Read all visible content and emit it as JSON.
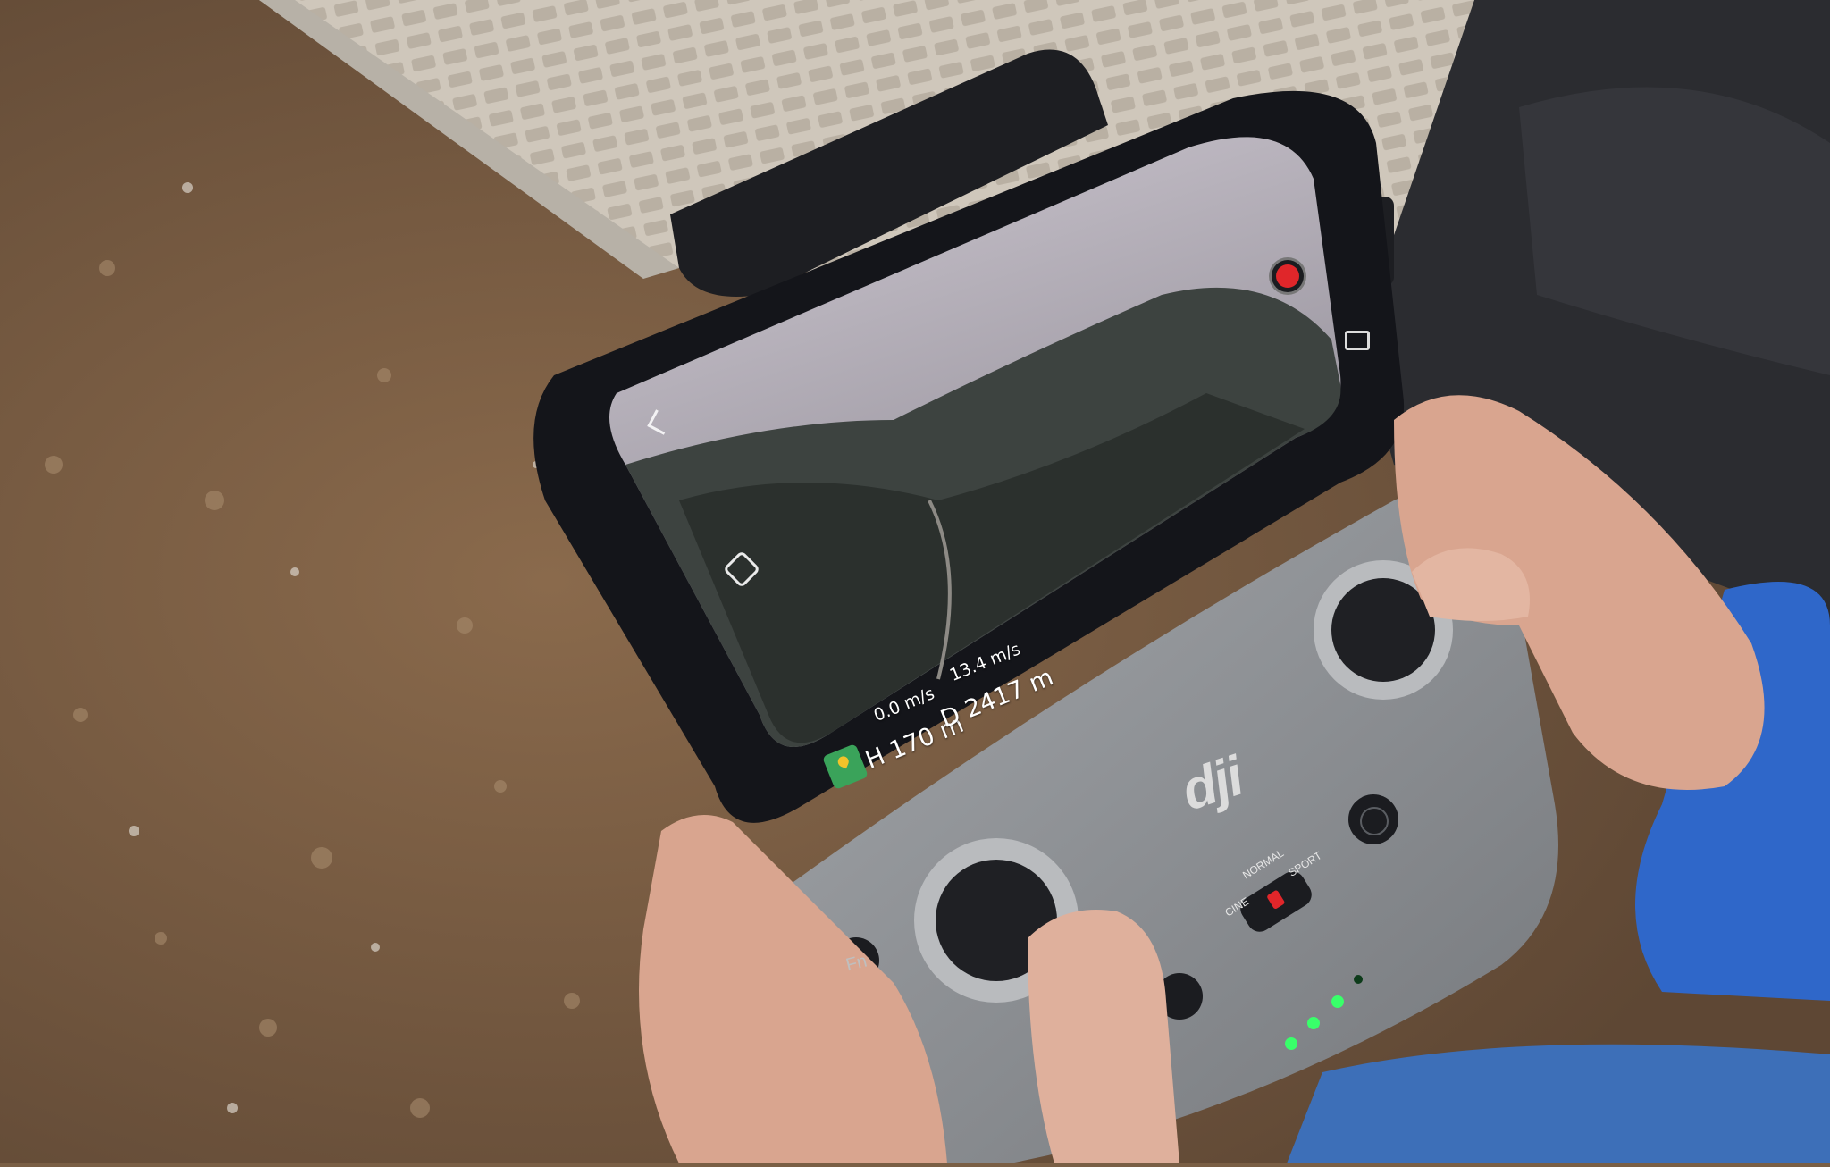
{
  "photo": {
    "subject": "dji-remote-controller-with-smartphone",
    "colors": {
      "ground": "#7a5f45",
      "paving": "#cbc3b7",
      "controller": "#8f9296",
      "phone_body": "#14151a",
      "jacket": "#2b2c30",
      "sleeve": "#2f67c9",
      "skin": "#d9a58f",
      "status_led": "#39ff6a",
      "record_button": "#e0262a"
    }
  },
  "flight_display": {
    "horizontal_speed": "0.0 m/s",
    "height": "H 170 m",
    "vertical_speed": "13.4 m/s",
    "distance": "D 2417 m",
    "icons": [
      "back-icon",
      "map-icon",
      "obstacle-icon",
      "camera-icon",
      "record-icon"
    ]
  },
  "controller": {
    "fn_label": "Fn",
    "brand_logo": "dji",
    "mode_normal": "NORMAL",
    "mode_cine": "CINE",
    "mode_sport": "SPORT",
    "battery_leds_lit": 3
  }
}
